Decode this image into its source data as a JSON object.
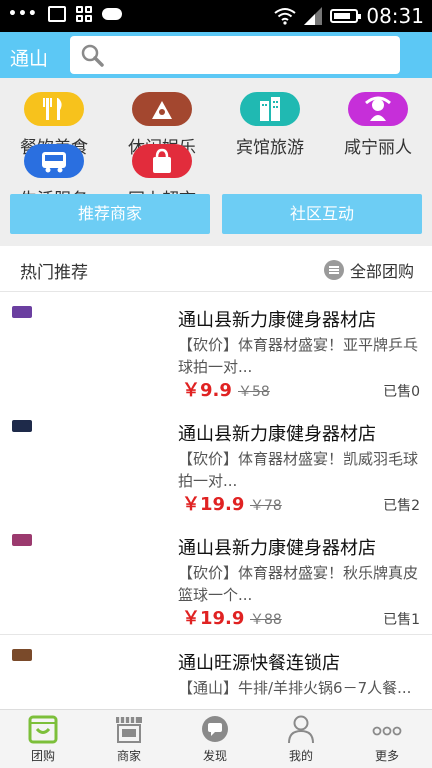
{
  "status_bar": {
    "time": "08:31",
    "dots": "•••"
  },
  "header": {
    "city": "通山",
    "search": {
      "placeholder": "",
      "value": ""
    }
  },
  "categories": [
    {
      "label": "餐饮美食",
      "icon": "fork-knife-icon",
      "color": "#f7c21c"
    },
    {
      "label": "休闲娱乐",
      "icon": "leisure-icon",
      "color": "#a3472f"
    },
    {
      "label": "宾馆旅游",
      "icon": "hotel-building-icon",
      "color": "#20b9b2"
    },
    {
      "label": "咸宁丽人",
      "icon": "beauty-icon",
      "color": "#c62fd9"
    },
    {
      "label": "生活服务",
      "icon": "bus-icon",
      "color": "#2a6fe0"
    },
    {
      "label": "网上超市",
      "icon": "shopping-bag-icon",
      "color": "#e22c3c"
    }
  ],
  "buttons": {
    "recommended_merchants": "推荐商家",
    "community": "社区互动"
  },
  "hot": {
    "title": "热门推荐",
    "all_deals": "全部团购"
  },
  "deals": [
    {
      "merchant": "通山县新力康健身器材店",
      "desc": "【砍价】体育器材盛宴！亚平牌乒乓球拍一对...",
      "price": "￥9.9",
      "original": "￥58",
      "sold": "已售0",
      "thumb_color": "#6b3fa0"
    },
    {
      "merchant": "通山县新力康健身器材店",
      "desc": "【砍价】体育器材盛宴！凯威羽毛球拍一对...",
      "price": "￥19.9",
      "original": "￥78",
      "sold": "已售2",
      "thumb_color": "#1e2a4a"
    },
    {
      "merchant": "通山县新力康健身器材店",
      "desc": "【砍价】体育器材盛宴！秋乐牌真皮篮球一个...",
      "price": "￥19.9",
      "original": "￥88",
      "sold": "已售1",
      "thumb_color": "#9b3a6e"
    },
    {
      "merchant": "通山旺源快餐连锁店",
      "desc": "【通山】牛排/羊排火锅6－7人餐...",
      "price": "",
      "original": "",
      "sold": "",
      "thumb_color": "#7a4a2a"
    }
  ],
  "tabs": [
    {
      "label": "团购",
      "icon": "basket-icon"
    },
    {
      "label": "商家",
      "icon": "storefront-icon"
    },
    {
      "label": "发现",
      "icon": "chat-bubble-icon"
    },
    {
      "label": "我的",
      "icon": "person-icon"
    },
    {
      "label": "更多",
      "icon": "more-dots-icon"
    }
  ],
  "colors": {
    "accent": "#5cc8f5",
    "price": "#e02222",
    "active_tab": "#7cbf3a"
  }
}
